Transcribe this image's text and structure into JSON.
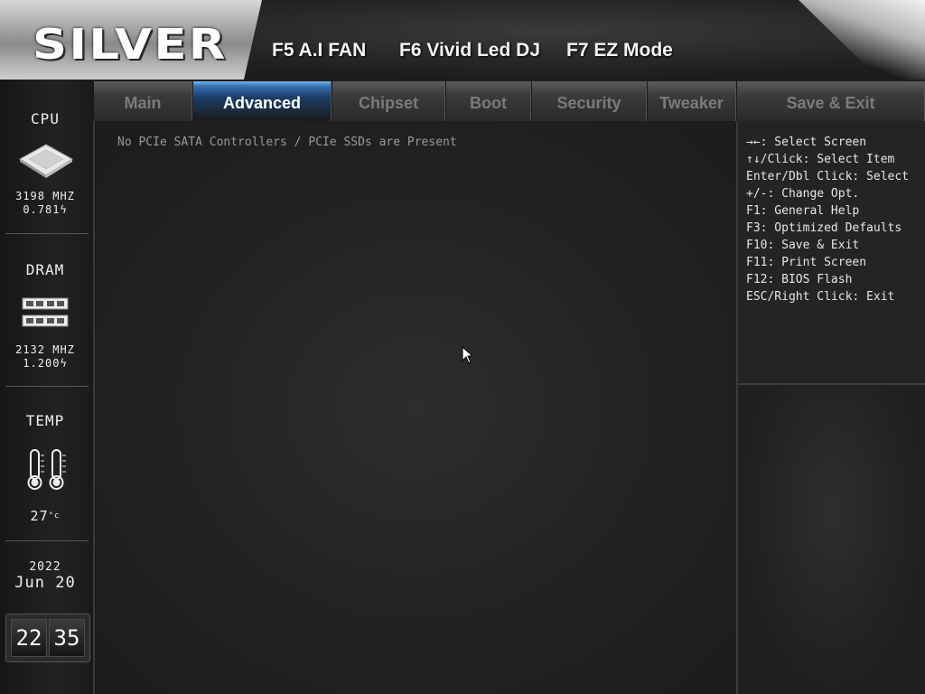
{
  "header": {
    "logo": "SILVER",
    "fn_keys": [
      "F5 A.I FAN",
      "F6 Vivid Led DJ",
      "F7 EZ Mode"
    ]
  },
  "sidebar": {
    "cpu": {
      "label": "CPU",
      "freq": "3198 MHZ",
      "volt": "0.781"
    },
    "dram": {
      "label": "DRAM",
      "freq": "2132 MHZ",
      "volt": "1.200"
    },
    "temp": {
      "label": "TEMP",
      "value": "27",
      "unit": "°c"
    },
    "date": {
      "year": "2022",
      "month": "Jun",
      "day": "20"
    },
    "time": {
      "hour": "22",
      "minute": "35"
    }
  },
  "tabs": [
    {
      "label": "Main",
      "active": false
    },
    {
      "label": "Advanced",
      "active": true
    },
    {
      "label": "Chipset",
      "active": false
    },
    {
      "label": "Boot",
      "active": false
    },
    {
      "label": "Security",
      "active": false
    },
    {
      "label": "Tweaker",
      "active": false
    },
    {
      "label": "Save & Exit",
      "active": false
    }
  ],
  "main": {
    "message": "No PCIe SATA Controllers / PCIe SSDs are Present"
  },
  "help": [
    "→←: Select Screen",
    "↑↓/Click: Select Item",
    "Enter/Dbl Click: Select",
    "+/-: Change Opt.",
    "F1: General Help",
    "F3: Optimized Defaults",
    "F10: Save & Exit",
    "F11: Print Screen",
    "F12: BIOS Flash",
    "ESC/Right Click: Exit"
  ],
  "colors": {
    "accent": "#3572b8",
    "background": "#1d1d1d",
    "text": "#e6e6e6",
    "inactive_tab_text": "#7b7b7b"
  },
  "icons": [
    "cpu-chip-icon",
    "dram-module-icon",
    "thermometer-icon",
    "volt-bolt-icon",
    "mouse-cursor-icon"
  ]
}
